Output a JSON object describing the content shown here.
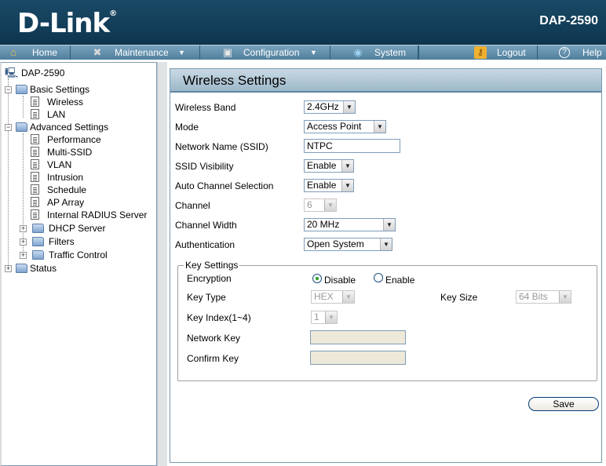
{
  "header": {
    "brand": "D-Link",
    "model": "DAP-2590"
  },
  "nav": {
    "home": "Home",
    "maintenance": "Maintenance",
    "configuration": "Configuration",
    "system": "System",
    "logout": "Logout",
    "help": "Help"
  },
  "tree": {
    "root": "DAP-2590",
    "basic": "Basic Settings",
    "wireless": "Wireless",
    "lan": "LAN",
    "advanced": "Advanced Settings",
    "performance": "Performance",
    "multissid": "Multi-SSID",
    "vlan": "VLAN",
    "intrusion": "Intrusion",
    "schedule": "Schedule",
    "aparray": "AP Array",
    "radius": "Internal RADIUS Server",
    "dhcp": "DHCP Server",
    "filters": "Filters",
    "traffic": "Traffic Control",
    "status": "Status"
  },
  "form": {
    "title": "Wireless Settings",
    "band_label": "Wireless Band",
    "band_value": "2.4GHz",
    "mode_label": "Mode",
    "mode_value": "Access Point",
    "ssid_label": "Network Name (SSID)",
    "ssid_value": "NTPC",
    "visibility_label": "SSID Visibility",
    "visibility_value": "Enable",
    "autochannel_label": "Auto Channel Selection",
    "autochannel_value": "Enable",
    "channel_label": "Channel",
    "channel_value": "6",
    "width_label": "Channel Width",
    "width_value": "20 MHz",
    "auth_label": "Authentication",
    "auth_value": "Open System",
    "key_settings": "Key Settings",
    "encryption_label": "Encryption",
    "enc_disable": "Disable",
    "enc_enable": "Enable",
    "keytype_label": "Key Type",
    "keytype_value": "HEX",
    "keysize_label": "Key Size",
    "keysize_value": "64 Bits",
    "keyindex_label": "Key Index(1~4)",
    "keyindex_value": "1",
    "netkey_label": "Network Key",
    "netkey_value": "",
    "confirmkey_label": "Confirm Key",
    "confirmkey_value": "",
    "save": "Save"
  }
}
